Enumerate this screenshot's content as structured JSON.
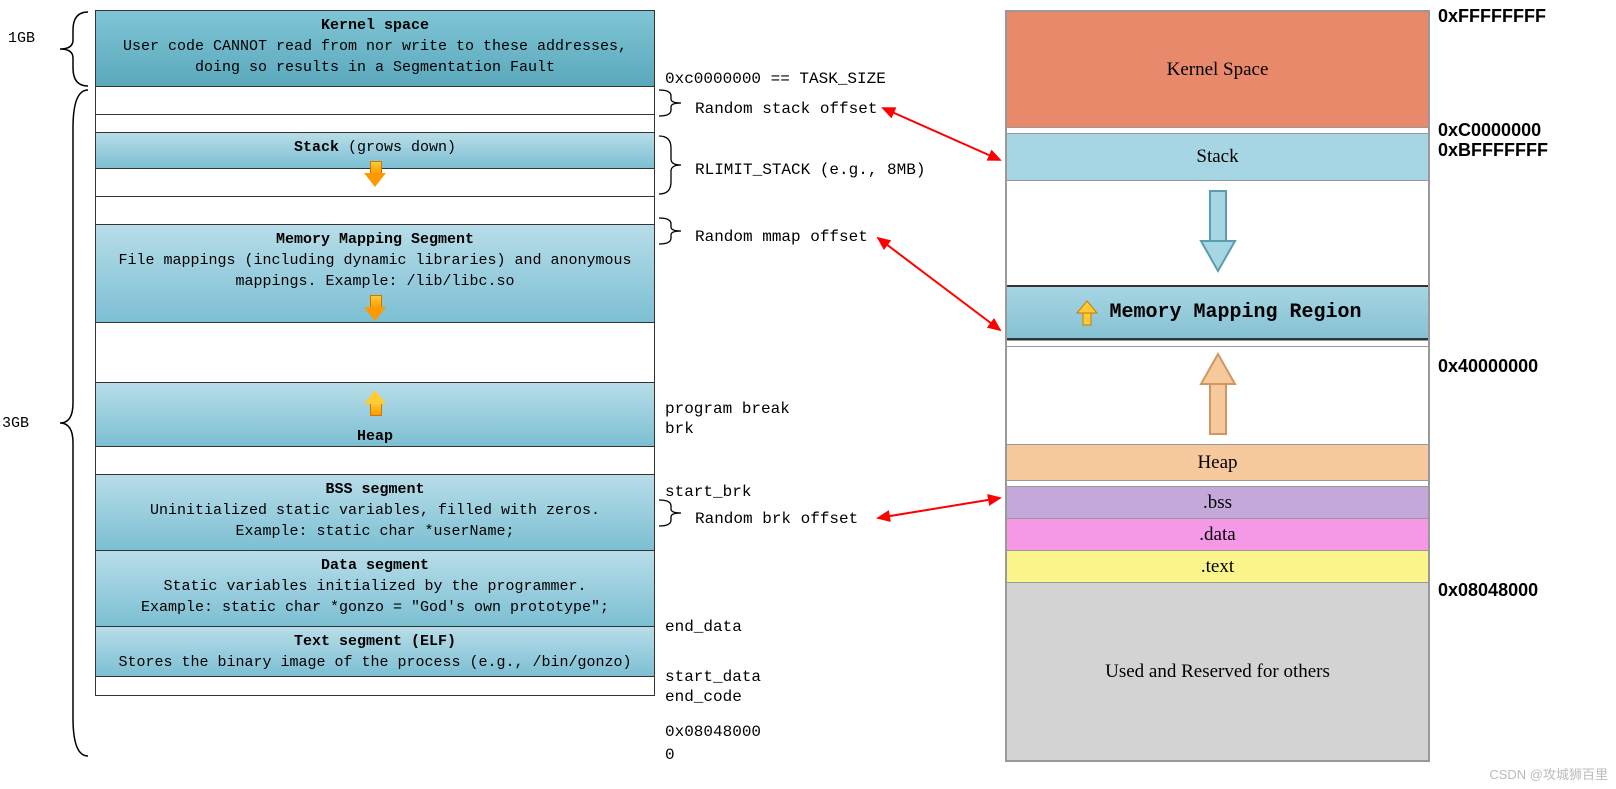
{
  "left_sizes": {
    "top": "1GB",
    "bottom": "3GB"
  },
  "segments": {
    "kernel": {
      "title": "Kernel space",
      "desc1": "User code CANNOT read from nor write to these addresses,",
      "desc2": "doing so results in a Segmentation Fault"
    },
    "stack": {
      "title": "Stack",
      "suffix": "(grows down)"
    },
    "mmap": {
      "title": "Memory Mapping Segment",
      "desc1": "File mappings (including dynamic libraries) and anonymous",
      "desc2": "mappings. Example: /lib/libc.so"
    },
    "heap": {
      "title": "Heap"
    },
    "bss": {
      "title": "BSS segment",
      "desc1": "Uninitialized static variables, filled with zeros.",
      "desc2": "Example: static char *userName;"
    },
    "data": {
      "title": "Data segment",
      "desc1": "Static variables initialized by the programmer.",
      "desc2": "Example: static char *gonzo = \"God's own prototype\";"
    },
    "text": {
      "title": "Text segment (ELF)",
      "desc1": "Stores the binary image of the process (e.g., /bin/gonzo)"
    }
  },
  "mid": {
    "task_size": "0xc0000000 == TASK_SIZE",
    "rand_stack": "Random stack offset",
    "rlimit": "RLIMIT_STACK (e.g., 8MB)",
    "rand_mmap": "Random mmap offset",
    "prog_break": "program break",
    "brk": "brk",
    "start_brk": "start_brk",
    "rand_brk": "Random brk offset",
    "end_data": "end_data",
    "start_data": "start_data",
    "end_code": "end_code",
    "addr_text": "0x08048000",
    "zero": "0"
  },
  "right": {
    "kernel": "Kernel Space",
    "stack": "Stack",
    "mmap": "Memory Mapping Region",
    "heap": "Heap",
    "bss": ".bss",
    "data": ".data",
    "text": ".text",
    "reserved": "Used and Reserved for others"
  },
  "addresses": {
    "a1": "0xFFFFFFFF",
    "a2": "0xC0000000",
    "a3": "0xBFFFFFFF",
    "a4": "0x40000000",
    "a5": "0x08048000"
  },
  "watermark": "CSDN @攻城狮百里"
}
